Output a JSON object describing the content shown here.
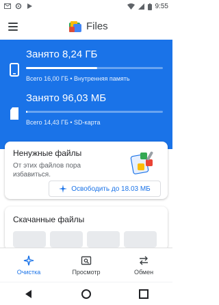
{
  "status_bar": {
    "time": "9:55",
    "icons": [
      "gmail-icon",
      "settings-icon",
      "play-store-icon",
      "wifi-icon",
      "signal-icon",
      "battery-icon"
    ]
  },
  "app_bar": {
    "title": "Files",
    "logo": "files-logo-icon",
    "menu_icon": "menu-icon"
  },
  "storage": {
    "internal": {
      "title": "Занято 8,24 ГБ",
      "subtitle": "Всего 16,00 ГБ • Внутренняя память",
      "fill_fraction": 0.52,
      "icon": "phone-icon"
    },
    "sd": {
      "title": "Занято 96,03 МБ",
      "subtitle": "Всего 14,43 ГБ • SD-карта",
      "fill_fraction": 0.01,
      "icon": "sd-card-icon"
    }
  },
  "junk_card": {
    "title": "Ненужные файлы",
    "description": "От этих файлов пора избавиться.",
    "button_label": "Освободить до 18.03 МБ",
    "illustration": "junk-files-illustration"
  },
  "downloads_card": {
    "title": "Скачанные файлы"
  },
  "bottom_nav": {
    "items": [
      {
        "label": "Очистка",
        "icon": "sparkle-icon",
        "active": true
      },
      {
        "label": "Просмотр",
        "icon": "browse-icon",
        "active": false
      },
      {
        "label": "Обмен",
        "icon": "swap-icon",
        "active": false
      }
    ]
  },
  "system_nav": {
    "buttons": [
      "back-icon",
      "home-icon",
      "recents-icon"
    ]
  },
  "colors": {
    "accent": "#1a73e8",
    "storage_bg": "#1a73e8"
  }
}
